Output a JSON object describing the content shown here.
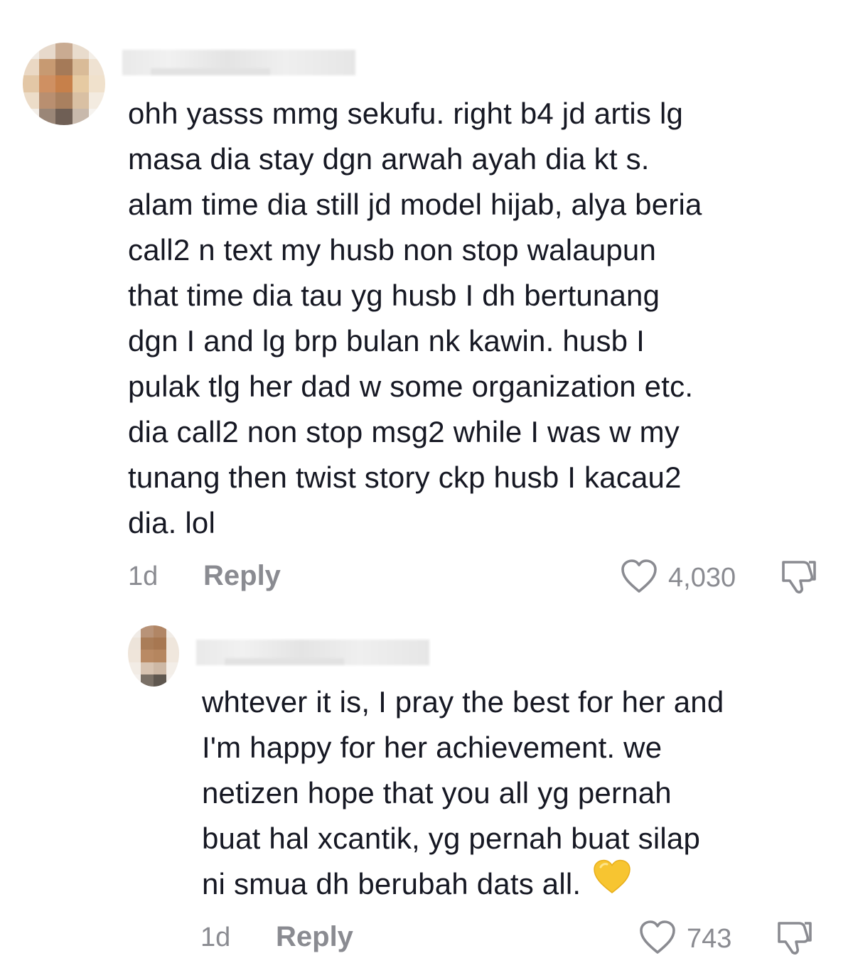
{
  "comments": [
    {
      "username": "",
      "text": "ohh yasss mmg sekufu. right b4 jd artis lg\nmasa dia stay dgn arwah ayah dia kt s.\nalam time dia still jd model hijab, alya beria\ncall2 n text my husb non stop walaupun\nthat time dia tau yg husb I dh bertunang\ndgn I and lg brp bulan nk kawin. husb I\npulak tlg her dad w some organization etc.\ndia call2 non stop msg2 while I was w my\ntunang then twist story ckp husb I kacau2\ndia. lol",
      "age": "1d",
      "reply_label": "Reply",
      "likes": "4,030"
    },
    {
      "username": "",
      "text": "whtever it is, I pray the best for her and\nI'm happy for her achievement. we\nnetizen hope that you all yg pernah\nbuat hal xcantik, yg pernah buat silap\nni smua dh berubah dats all.",
      "emoji": "yellow-heart",
      "age": "1d",
      "reply_label": "Reply",
      "likes": "743"
    }
  ],
  "icons": {
    "like": "heart-outline-icon",
    "dislike": "thumbs-down-outline-icon",
    "emoji": "yellow-heart-emoji"
  },
  "colors": {
    "text": "#161823",
    "muted": "#8a8b91",
    "emoji_yellow": "#f7c531"
  }
}
